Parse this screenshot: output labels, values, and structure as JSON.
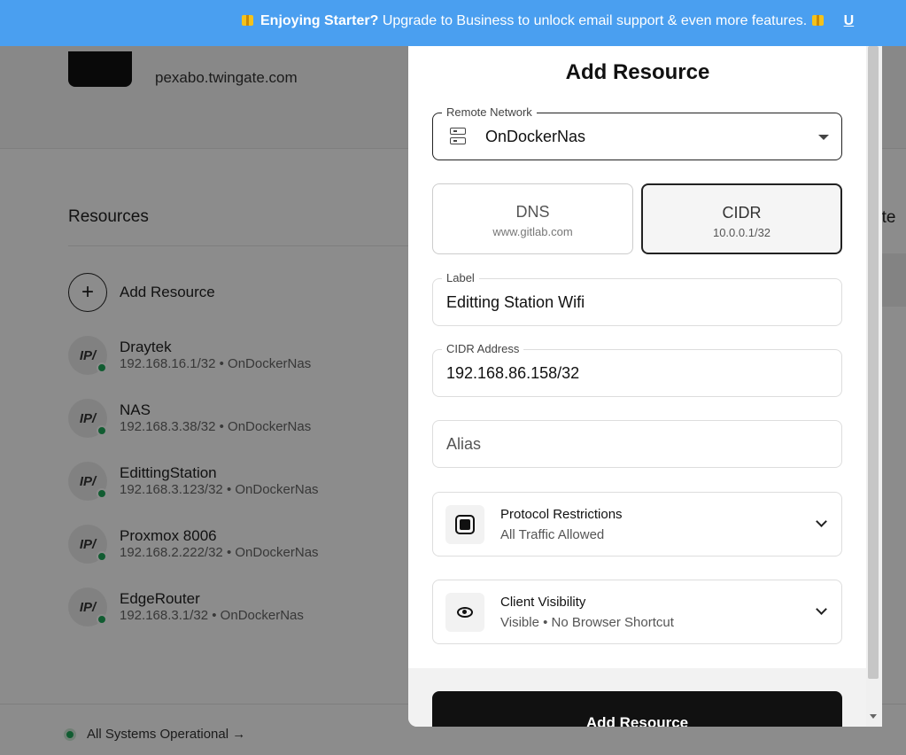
{
  "banner": {
    "lead": "Enjoying Starter?",
    "text": "Upgrade to Business to unlock email support & even more features.",
    "link": "U"
  },
  "network": {
    "url": "pexabo.twingate.com"
  },
  "resources": {
    "title": "Resources",
    "add_label": "Add Resource",
    "badge": "IP/",
    "items": [
      {
        "name": "Draytek",
        "detail": "192.168.16.1/32 • OnDockerNas"
      },
      {
        "name": "NAS",
        "detail": "192.168.3.38/32 • OnDockerNas"
      },
      {
        "name": "EdittingStation",
        "detail": "192.168.3.123/32 • OnDockerNas"
      },
      {
        "name": "Proxmox 8006",
        "detail": "192.168.2.222/32 • OnDockerNas"
      },
      {
        "name": "EdgeRouter",
        "detail": "192.168.3.1/32 • OnDockerNas"
      }
    ]
  },
  "right_panel": {
    "label": "ote"
  },
  "status": {
    "text": "All Systems Operational →"
  },
  "modal": {
    "title": "Add Resource",
    "remote_network": {
      "legend": "Remote Network",
      "value": "OnDockerNas"
    },
    "type_dns": {
      "title": "DNS",
      "example": "www.gitlab.com"
    },
    "type_cidr": {
      "title": "CIDR",
      "example": "10.0.0.1/32"
    },
    "label_field": {
      "legend": "Label",
      "value": "Editting Station Wifi"
    },
    "cidr_field": {
      "legend": "CIDR Address",
      "value": "192.168.86.158/32"
    },
    "alias_field": {
      "placeholder": "Alias"
    },
    "protocol": {
      "title": "Protocol Restrictions",
      "subtitle": "All Traffic Allowed"
    },
    "visibility": {
      "title": "Client Visibility",
      "subtitle": "Visible • No Browser Shortcut"
    },
    "submit_label": "Add Resource"
  },
  "colors": {
    "banner": "#4a9ff0",
    "online": "#1fa85a",
    "primary_button": "#111111"
  },
  "icons": [
    "gift-icon",
    "plus-icon",
    "server-icon",
    "chevron-down-icon",
    "stop-square-icon",
    "eye-icon",
    "status-dot-icon"
  ]
}
